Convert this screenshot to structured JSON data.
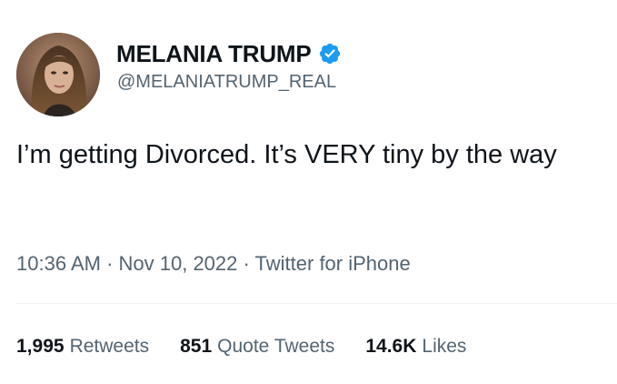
{
  "author": {
    "display_name": "MELANIA TRUMP",
    "handle": "@MELANIATRUMP_REAL",
    "verified": true,
    "verified_icon": "verified-badge-icon",
    "verified_color": "#1d9bf0"
  },
  "tweet": {
    "text": "I’m getting Divorced. It’s VERY tiny by the way"
  },
  "meta": {
    "time": "10:36 AM",
    "separator_1": " · ",
    "date": "Nov 10, 2022",
    "separator_2": " · ",
    "source": "Twitter for iPhone"
  },
  "stats": {
    "retweets": {
      "count": "1,995",
      "label": "Retweets"
    },
    "quote_tweets": {
      "count": "851",
      "label": "Quote Tweets"
    },
    "likes": {
      "count": "14.6K",
      "label": "Likes"
    }
  },
  "colors": {
    "text_primary": "#0f1419",
    "text_secondary": "#536471",
    "divider": "#eff3f4",
    "verified": "#1d9bf0"
  }
}
